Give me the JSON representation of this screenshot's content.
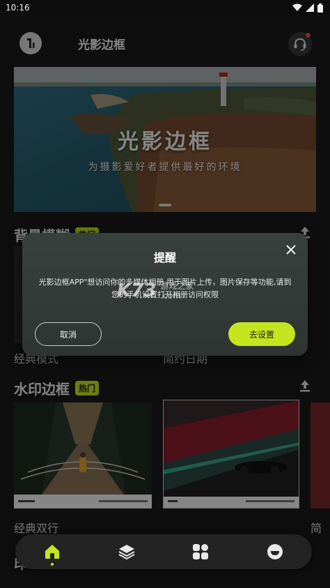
{
  "status_bar": {
    "time": "10:16"
  },
  "header": {
    "title": "光影边框"
  },
  "banner": {
    "title": "光影边框",
    "subtitle": "为摄影爱好者提供最好的环境"
  },
  "sections": {
    "blur": {
      "title": "背景模糊",
      "badge": "热门",
      "captions": [
        "经典模式",
        "简约日期"
      ]
    },
    "watermark": {
      "title": "水印边框",
      "badge": "热门",
      "captions": [
        "经典双行",
        "简"
      ]
    },
    "partial_next_title": "印"
  },
  "dialog": {
    "title": "提醒",
    "message": "光影边框APP\"想访问你的多媒体相册 用于图片上传，图片保存等功能,请到您的手机设置打开相册访问权限",
    "cancel_label": "取消",
    "confirm_label": "去设置"
  },
  "watermark_overlay": {
    "logo": "K73",
    "line1": "游戏之家",
    "line2": ".com"
  },
  "tabs": [
    "home-icon",
    "layers-icon",
    "grid-icon",
    "profile-icon"
  ],
  "colors": {
    "accent": "#c5e61f",
    "background": "#1a1a1a",
    "dialog": "#353b39"
  }
}
